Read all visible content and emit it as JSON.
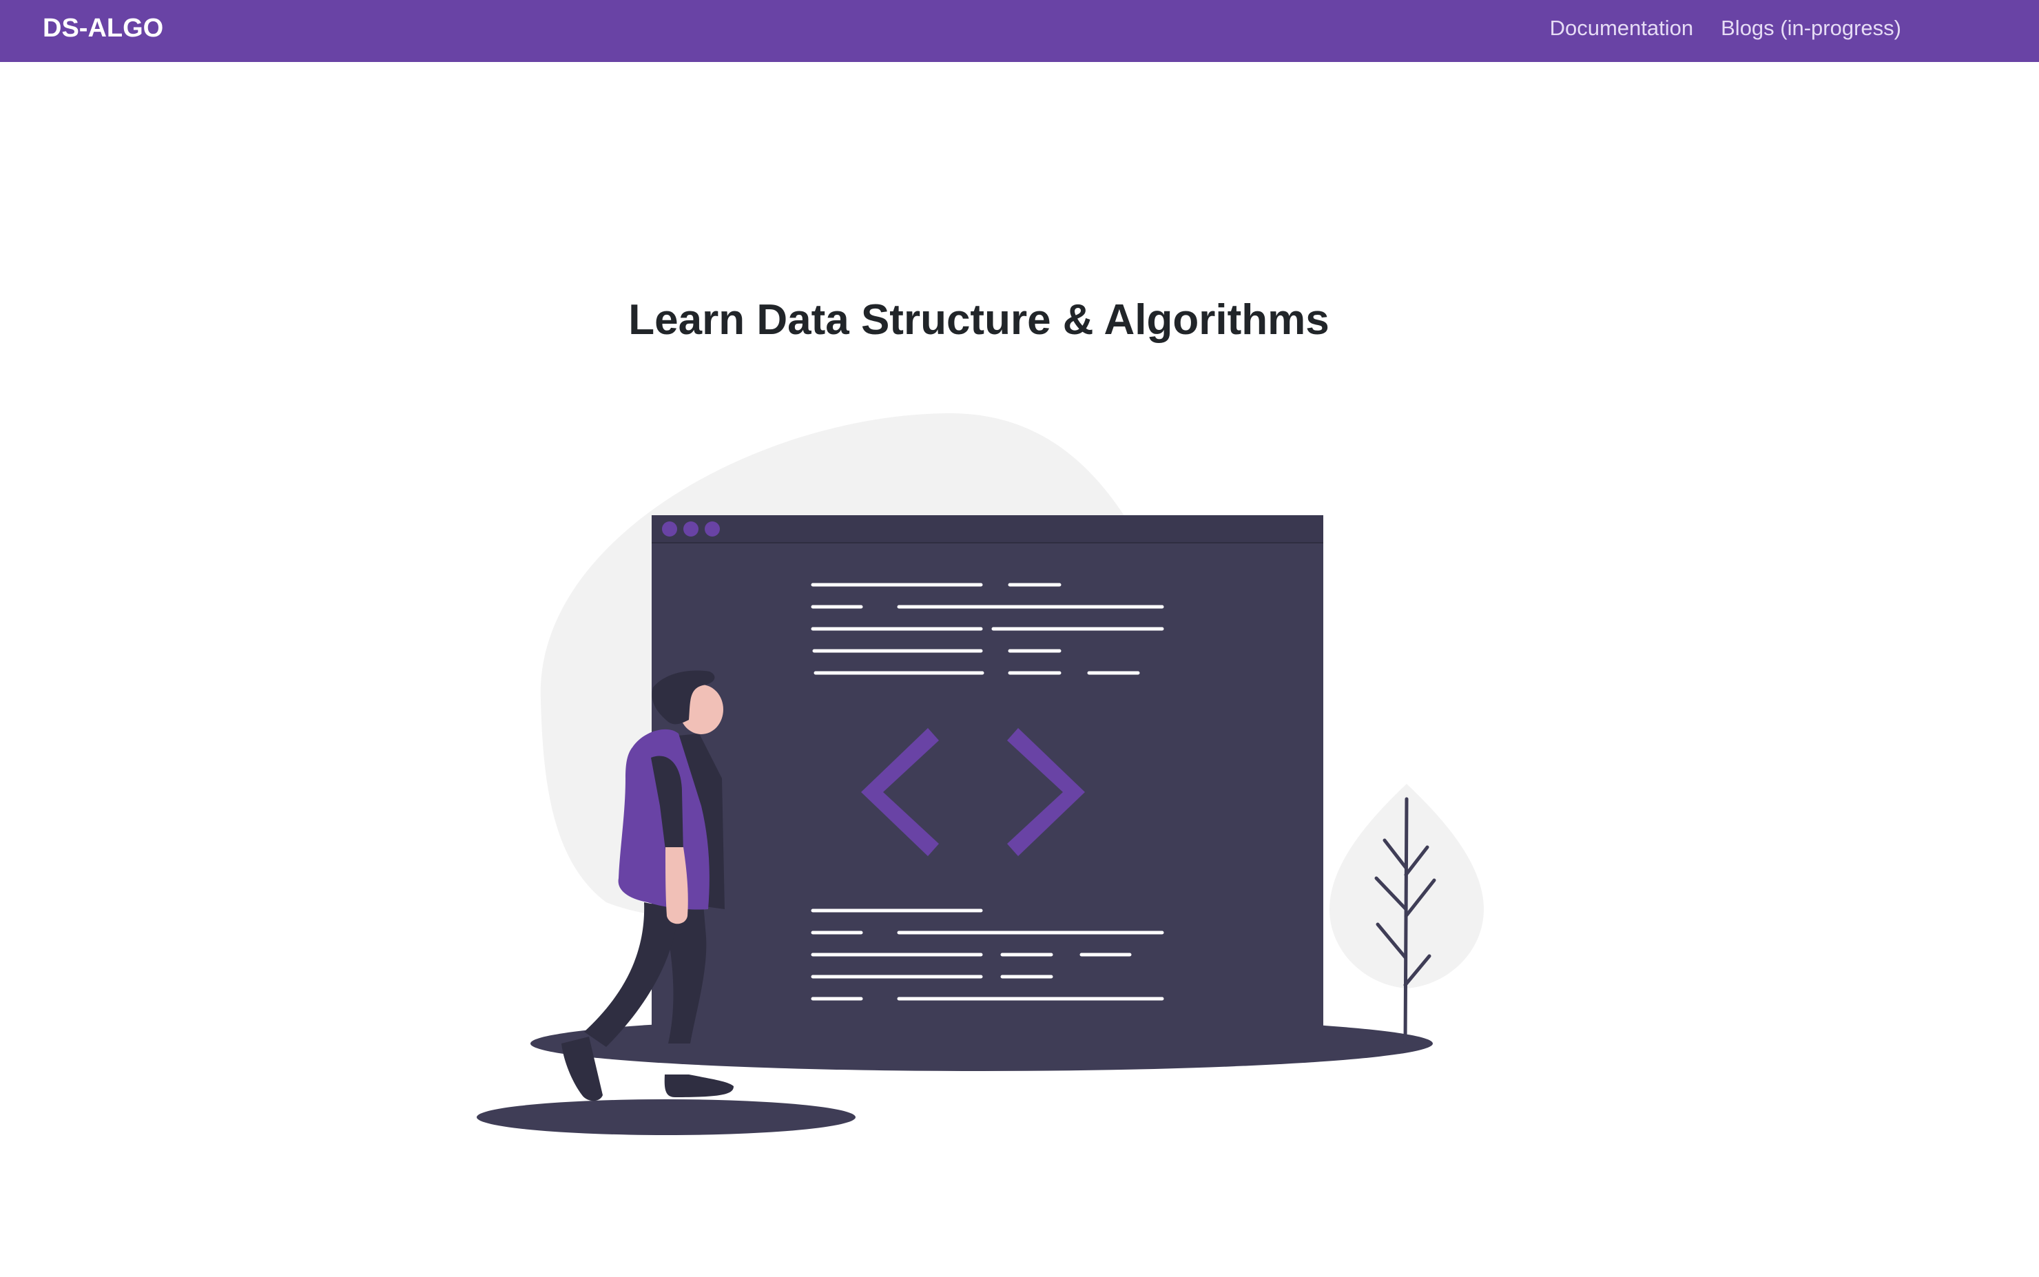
{
  "navbar": {
    "brand": "DS-ALGO",
    "links": [
      {
        "label": "Documentation"
      },
      {
        "label": "Blogs (in-progress)"
      }
    ]
  },
  "hero": {
    "title": "Learn Data Structure & Algorithms",
    "illustration": {
      "code_symbol": "< >",
      "colors": {
        "accent": "#6943a5",
        "screen": "#3f3d56",
        "blob": "#f2f2f2",
        "skin": "#f1c0b7",
        "dark": "#2f2e41"
      }
    }
  }
}
